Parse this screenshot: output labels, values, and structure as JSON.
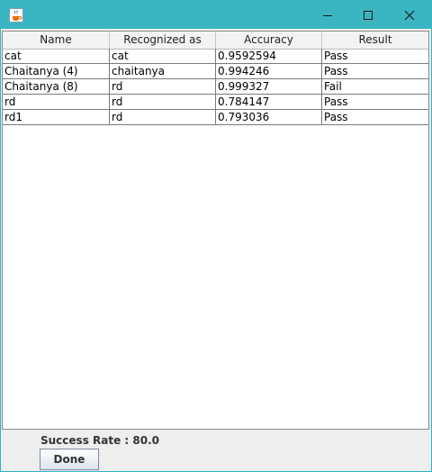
{
  "window": {
    "controls": {
      "minimize_icon": "minimize-icon",
      "maximize_icon": "maximize-icon",
      "close_icon": "close-icon"
    },
    "titlebar_color": "#3bb5c2"
  },
  "table": {
    "columns": [
      "Name",
      "Recognized as",
      "Accuracy",
      "Result"
    ],
    "rows": [
      [
        "cat",
        "cat",
        "0.9592594",
        "Pass"
      ],
      [
        "Chaitanya (4)",
        "chaitanya",
        "0.994246",
        "Pass"
      ],
      [
        "Chaitanya (8)",
        "rd",
        "0.999327",
        "Fail"
      ],
      [
        "rd",
        "rd",
        "0.784147",
        "Pass"
      ],
      [
        "rd1",
        "rd",
        "0.793036",
        "Pass"
      ]
    ]
  },
  "footer": {
    "success_rate": "Success Rate : 80.0",
    "done_label": "Done"
  }
}
